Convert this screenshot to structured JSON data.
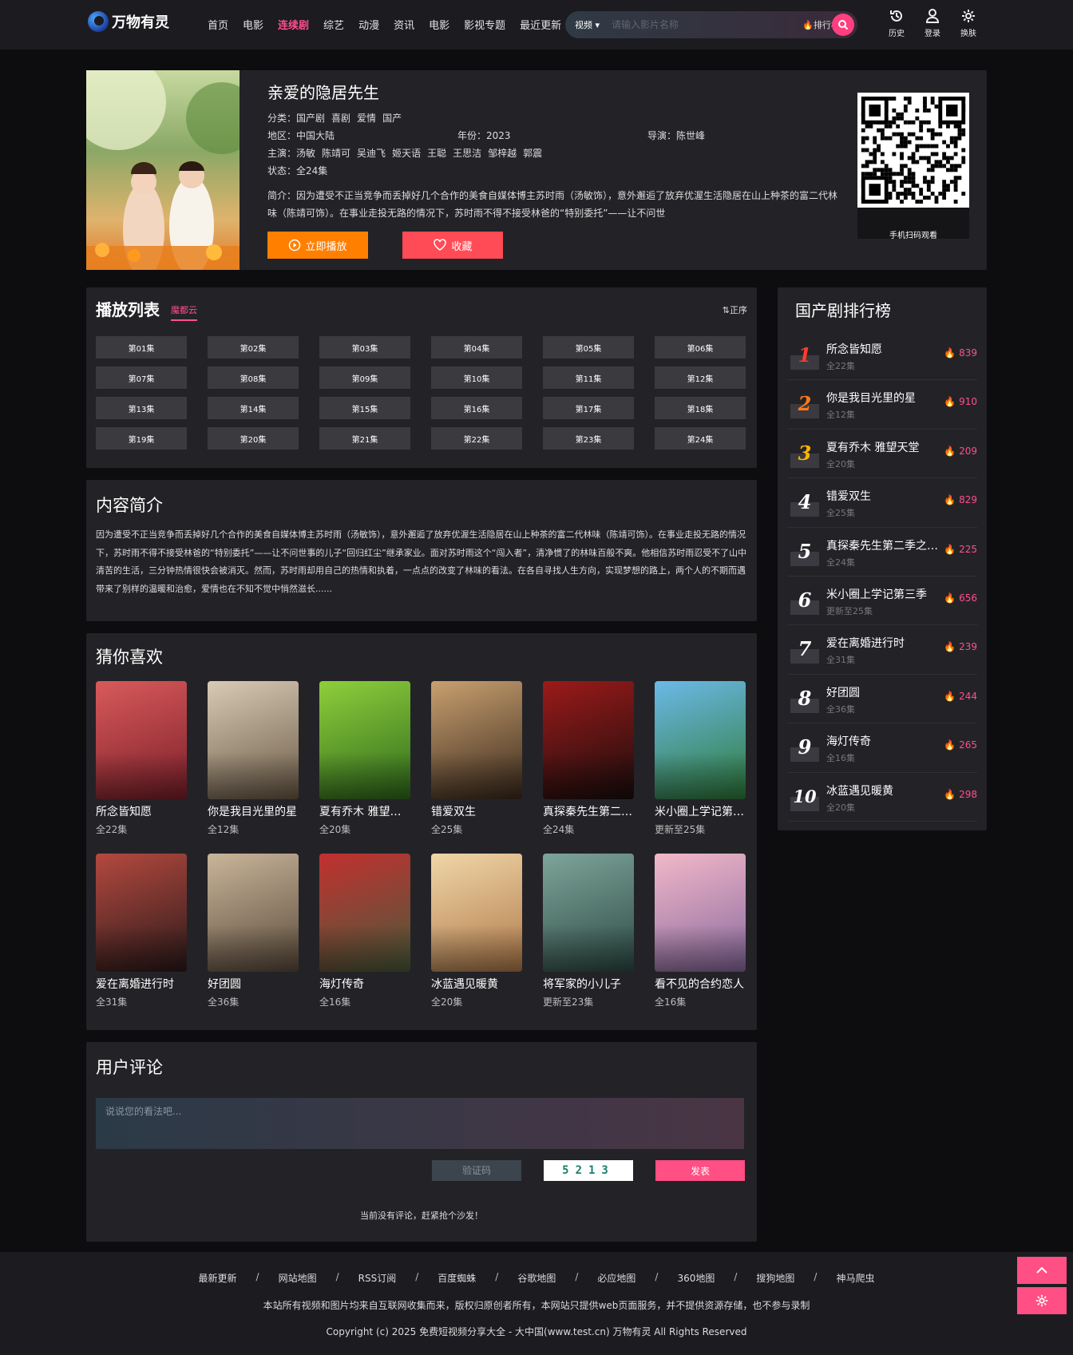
{
  "header": {
    "logo_text": "万物有灵",
    "nav": [
      "首页",
      "电影",
      "连续剧",
      "综艺",
      "动漫",
      "资讯",
      "电影",
      "影视专题",
      "最近更新"
    ],
    "active_nav_index": 2,
    "search": {
      "category": "视频",
      "placeholder": "请输入影片名称",
      "rank_label": "排行榜"
    },
    "tools": [
      {
        "label": "历史",
        "icon": "history-icon"
      },
      {
        "label": "登录",
        "icon": "user-icon"
      },
      {
        "label": "换肤",
        "icon": "gear-icon"
      }
    ]
  },
  "detail": {
    "title": "亲爱的隐居先生",
    "category_label": "分类：",
    "categories": [
      "国产剧",
      "喜剧",
      "爱情",
      "国产"
    ],
    "region_label": "地区：",
    "region": "中国大陆",
    "year_label": "年份：",
    "year": "2023",
    "director_label": "导演：",
    "director": "陈世峰",
    "cast_label": "主演：",
    "cast": [
      "汤敏",
      "陈靖可",
      "吴迪飞",
      "姬天语",
      "王聪",
      "王思洁",
      "邹梓越",
      "郭震"
    ],
    "status_label": "状态：",
    "status": "全24集",
    "intro_label": "简介：",
    "intro": "因为遭受不正当竞争而丢掉好几个合作的美食自媒体博主苏时雨（汤敏饰），意外邂逅了放弃优渥生活隐居在山上种茶的富二代林味（陈靖可饰）。在事业走投无路的情况下，苏时雨不得不接受林爸的“特别委托”——让不问世",
    "play_label": "立即播放",
    "fav_label": "收藏",
    "qr_caption": "手机扫码观看"
  },
  "playlist": {
    "title": "播放列表",
    "source": "魔都云",
    "sort_label": "正序",
    "episodes": [
      "第01集",
      "第02集",
      "第03集",
      "第04集",
      "第05集",
      "第06集",
      "第07集",
      "第08集",
      "第09集",
      "第10集",
      "第11集",
      "第12集",
      "第13集",
      "第14集",
      "第15集",
      "第16集",
      "第17集",
      "第18集",
      "第19集",
      "第20集",
      "第21集",
      "第22集",
      "第23集",
      "第24集"
    ]
  },
  "synopsis": {
    "title": "内容简介",
    "text": "因为遭受不正当竞争而丢掉好几个合作的美食自媒体博主苏时雨（汤敏饰），意外邂逅了放弃优渥生活隐居在山上种茶的富二代林味（陈靖可饰）。在事业走投无路的情况下，苏时雨不得不接受林爸的“特别委托”——让不问世事的儿子“回归红尘”继承家业。面对苏时雨这个“闯入者”，清净惯了的林味百般不爽。他相信苏时雨忍受不了山中清苦的生活，三分钟热情很快会被消灭。然而，苏时雨却用自己的热情和执着，一点点的改变了林味的看法。在各自寻找人生方向，实现梦想的路上，两个人的不期而遇带来了别样的温暖和治愈，爱情也在不知不觉中悄然滋长......"
  },
  "recommend": {
    "title": "猜你喜欢",
    "items": [
      {
        "title": "所念皆知愿",
        "sub": "全22集",
        "colors": [
          "#d95a5a",
          "#7a1f2a"
        ]
      },
      {
        "title": "你是我目光里的星",
        "sub": "全12集",
        "colors": [
          "#d8cbb6",
          "#6b5a46"
        ]
      },
      {
        "title": "夏有乔木 雅望天堂",
        "sub": "全20集",
        "colors": [
          "#8fcf3c",
          "#2f6a1c"
        ]
      },
      {
        "title": "错爱双生",
        "sub": "全25集",
        "colors": [
          "#c9a070",
          "#3b2a1d"
        ]
      },
      {
        "title": "真探秦先生第二季之鬼相",
        "sub": "全24集",
        "colors": [
          "#9c1a1a",
          "#1a0d0d"
        ]
      },
      {
        "title": "米小圈上学记第三季",
        "sub": "更新至25集",
        "colors": [
          "#6bb9e8",
          "#2f7b3a"
        ]
      },
      {
        "title": "爱在离婚进行时",
        "sub": "全31集",
        "colors": [
          "#b4493f",
          "#2b1a1a"
        ]
      },
      {
        "title": "好团圆",
        "sub": "全36集",
        "colors": [
          "#c9b59a",
          "#5b4b3c"
        ]
      },
      {
        "title": "海灯传奇",
        "sub": "全16集",
        "colors": [
          "#c23030",
          "#4a5c3a"
        ]
      },
      {
        "title": "冰蓝遇见暖黄",
        "sub": "全20集",
        "colors": [
          "#f0d6a8",
          "#b07a4a"
        ]
      },
      {
        "title": "将军家的小儿子",
        "sub": "更新至23集",
        "colors": [
          "#7ea59a",
          "#2d4a44"
        ]
      },
      {
        "title": "看不见的合约恋人",
        "sub": "全16集",
        "colors": [
          "#f2b8c8",
          "#8a6aa0"
        ]
      }
    ]
  },
  "comments": {
    "title": "用户评论",
    "placeholder": "说说您的看法吧...",
    "captcha_placeholder": "验证码",
    "captcha_text": "5213",
    "submit_label": "发表",
    "empty_text": "当前没有评论，赶紧抢个沙发！"
  },
  "ranking": {
    "title": "国产剧排行榜",
    "items": [
      {
        "rank": "1",
        "name": "所念皆知愿",
        "sub": "全22集",
        "hot": "839",
        "color": "#ff3c2e"
      },
      {
        "rank": "2",
        "name": "你是我目光里的星",
        "sub": "全12集",
        "hot": "910",
        "color": "#ff7a1a"
      },
      {
        "rank": "3",
        "name": "夏有乔木 雅望天堂",
        "sub": "全20集",
        "hot": "209",
        "color": "#ffb400"
      },
      {
        "rank": "4",
        "name": "错爱双生",
        "sub": "全25集",
        "hot": "829",
        "color": "#ffffff"
      },
      {
        "rank": "5",
        "name": "真探秦先生第二季之鬼相",
        "sub": "全24集",
        "hot": "225",
        "color": "#ffffff"
      },
      {
        "rank": "6",
        "name": "米小圈上学记第三季",
        "sub": "更新至25集",
        "hot": "656",
        "color": "#ffffff"
      },
      {
        "rank": "7",
        "name": "爱在离婚进行时",
        "sub": "全31集",
        "hot": "239",
        "color": "#ffffff"
      },
      {
        "rank": "8",
        "name": "好团圆",
        "sub": "全36集",
        "hot": "244",
        "color": "#ffffff"
      },
      {
        "rank": "9",
        "name": "海灯传奇",
        "sub": "全16集",
        "hot": "265",
        "color": "#ffffff"
      },
      {
        "rank": "10",
        "name": "冰蓝遇见暖黄",
        "sub": "全20集",
        "hot": "298",
        "color": "#ffffff"
      }
    ]
  },
  "footer": {
    "links": [
      "最新更新",
      "网站地图",
      "RSS订阅",
      "百度蜘蛛",
      "谷歌地图",
      "必应地图",
      "360地图",
      "搜狗地图",
      "神马爬虫"
    ],
    "separator": "/",
    "disclaimer": "本站所有视频和图片均来自互联网收集而来，版权归原创者所有，本网站只提供web页面服务，并不提供资源存储，也不参与录制",
    "copyright": "Copyright (c) 2025 免费短视频分享大全 - 大中国(www.test.cn) 万物有灵 All Rights Reserved"
  },
  "colors": {
    "accent": "#ff4f84",
    "play": "#ff7f00",
    "fav": "#ff4b55",
    "panel": "#232327",
    "bg": "#0d0d0f"
  }
}
